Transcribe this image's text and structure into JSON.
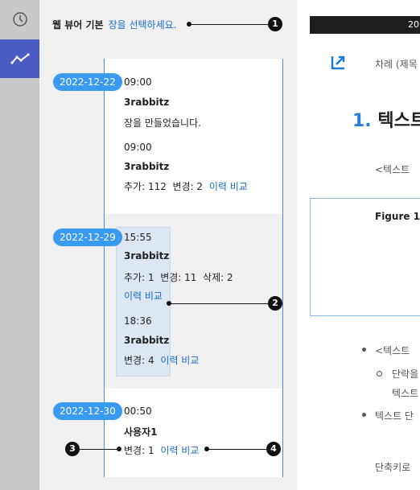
{
  "rail": {
    "items": [
      {
        "icon": "history-clock-icon"
      },
      {
        "icon": "trend-line-icon",
        "active": true
      }
    ]
  },
  "header": {
    "title": "웹 뷰어 기본",
    "subtitle": "장을 선택하세요."
  },
  "groups": [
    {
      "date": "2022-12-22",
      "entries": [
        {
          "time": "09:00",
          "author": "3rabbitz",
          "text": "장을 만들었습니다."
        },
        {
          "time": "09:00",
          "author": "3rabbitz",
          "stats": "추가: 112  변경: 2",
          "link": "이력 비교"
        }
      ]
    },
    {
      "date": "2022-12-29",
      "entries": [
        {
          "time": "15:55",
          "author": "3rabbitz",
          "stats": "추가: 1  변경: 11  삭제: 2",
          "link": "이력 비교"
        },
        {
          "time": "18:36",
          "author": "3rabbitz",
          "stats": "변경: 4",
          "link": "이력 비교"
        }
      ]
    },
    {
      "date": "2022-12-30",
      "entries": [
        {
          "time": "00:50",
          "author": "사용자1",
          "stats": "변경: 1",
          "link": "이력 비교"
        }
      ]
    }
  ],
  "callouts": [
    "1",
    "2",
    "3",
    "4"
  ],
  "doc": {
    "topbar": "20",
    "toc": "차례 (제목",
    "heading_num": "1.",
    "heading": "텍스트",
    "p1": "<텍스트 ",
    "figure": "Figure 1.",
    "li1": "<텍스트 ",
    "li2": "단락을",
    "li2b": "텍스트",
    "li3": "텍스트 단",
    "p2": "단축키로"
  }
}
